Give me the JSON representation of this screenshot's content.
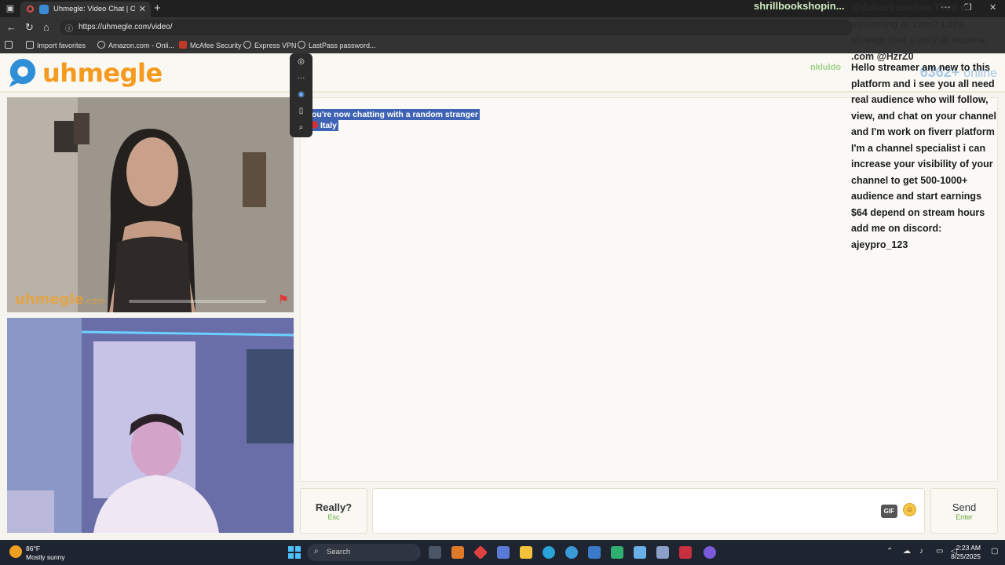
{
  "browser": {
    "tab_title": "Uhmegle: Video Chat | Omeg",
    "url": "https://uhmegle.com/video/",
    "favorites": [
      {
        "label": "Import favorites",
        "icon": "import-icon"
      },
      {
        "label": "Amazon.com - Onli...",
        "icon": "globe-icon"
      },
      {
        "label": "McAfee Security",
        "icon": "mcafee-icon"
      },
      {
        "label": "Express VPN",
        "icon": "globe-icon"
      },
      {
        "label": "LastPass password...",
        "icon": "globe-icon"
      }
    ]
  },
  "site": {
    "logo_text": "uhmegle",
    "online_count": "6362+",
    "online_label": "online",
    "video_watermark": "uhmegle",
    "video_watermark_suffix": ".com"
  },
  "chat": {
    "system_message": "ou're now chatting with a random stranger",
    "country": "Italy",
    "stop_label": "Really?",
    "stop_hint": "Esc",
    "gif_label": "GIF",
    "send_label": "Send",
    "send_hint": "Enter",
    "input_value": ""
  },
  "stream_overlay": {
    "top_username": "shrillbookshopin...",
    "viewer_name": "nkluldo",
    "note_lines": [
      "@dallasfromtheo Tired of",
      "streaming to zero? Let's",
      "change that – only at nezhna",
      ".com @HzrZ0"
    ],
    "message_lines": [
      "Hello streamer am new to this",
      "platform and i see you all need",
      "real audience who will follow,",
      "view, and chat on your channel",
      "and I'm work on fiverr platform",
      "I'm a channel specialist i can",
      "increase your visibility of your",
      "channel to get 500-1000+",
      "audience and start earnings",
      "$64 depend on stream hours",
      "add me on discord:",
      "ajeypro_123"
    ]
  },
  "taskbar": {
    "temperature": "86°F",
    "weather": "Mostly sunny",
    "search_placeholder": "Search",
    "time": "2:23 AM",
    "date": "8/25/2025"
  },
  "colors": {
    "brand_orange": "#f49a1e",
    "brand_blue": "#2f8ed8",
    "selection_blue": "#3e63b5"
  }
}
